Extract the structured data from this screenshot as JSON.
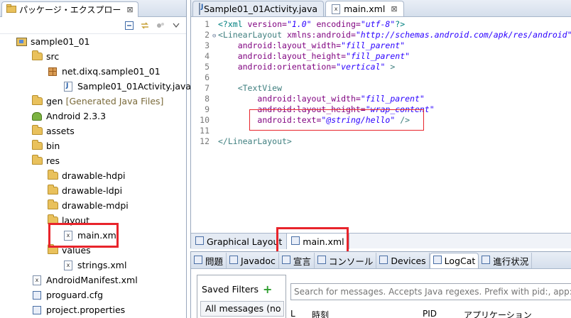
{
  "explorer": {
    "tab_title": "パッケージ・エクスプロー",
    "tab_close": "⊠",
    "tree": [
      {
        "label": "sample01_01",
        "icon": "project-icon",
        "indent": 0
      },
      {
        "label": "src",
        "icon": "folder-icon",
        "indent": 1
      },
      {
        "label": "net.dixq.sample01_01",
        "icon": "package-icon",
        "indent": 2
      },
      {
        "label": "Sample01_01Activity.java",
        "icon": "java-file-icon",
        "indent": 3
      },
      {
        "label": "gen",
        "extra": "[Generated Java Files]",
        "icon": "folder-icon",
        "indent": 1
      },
      {
        "label": "Android 2.3.3",
        "icon": "android-library-icon",
        "indent": 1
      },
      {
        "label": "assets",
        "icon": "folder-icon",
        "indent": 1
      },
      {
        "label": "bin",
        "icon": "folder-icon",
        "indent": 1
      },
      {
        "label": "res",
        "icon": "folder-icon",
        "indent": 1
      },
      {
        "label": "drawable-hdpi",
        "icon": "folder-icon",
        "indent": 2
      },
      {
        "label": "drawable-ldpi",
        "icon": "folder-icon",
        "indent": 2
      },
      {
        "label": "drawable-mdpi",
        "icon": "folder-icon",
        "indent": 2
      },
      {
        "label": "layout",
        "icon": "folder-icon",
        "indent": 2
      },
      {
        "label": "main.xml",
        "icon": "xml-file-icon",
        "indent": 3
      },
      {
        "label": "values",
        "icon": "folder-icon",
        "indent": 2
      },
      {
        "label": "strings.xml",
        "icon": "xml-file-icon",
        "indent": 3
      },
      {
        "label": "AndroidManifest.xml",
        "icon": "xml-file-icon",
        "indent": 1
      },
      {
        "label": "proguard.cfg",
        "icon": "file-icon",
        "indent": 1
      },
      {
        "label": "project.properties",
        "icon": "file-icon",
        "indent": 1
      }
    ]
  },
  "editor": {
    "tabs": [
      {
        "label": "Sample01_01Activity.java",
        "icon": "java-file-icon",
        "active": false
      },
      {
        "label": "main.xml",
        "icon": "xml-file-icon",
        "active": true,
        "close": "⊠"
      }
    ],
    "lines": [
      {
        "n": "1",
        "html": [
          [
            "pi",
            "<?xml "
          ],
          [
            "attr",
            "version="
          ],
          [
            "val",
            "\"1.0\""
          ],
          [
            "attr",
            " encoding="
          ],
          [
            "val",
            "\"utf-8\""
          ],
          [
            "pi",
            "?>"
          ]
        ]
      },
      {
        "n": "2",
        "fold": "⊖",
        "html": [
          [
            "tag",
            "<LinearLayout "
          ],
          [
            "attr",
            "xmlns:android="
          ],
          [
            "val",
            "\"http://schemas.android.com/apk/res/android\""
          ]
        ]
      },
      {
        "n": "3",
        "html": [
          [
            "tag",
            "    "
          ],
          [
            "attr",
            "android:layout_width="
          ],
          [
            "val",
            "\"fill_parent\""
          ]
        ]
      },
      {
        "n": "4",
        "html": [
          [
            "tag",
            "    "
          ],
          [
            "attr",
            "android:layout_height="
          ],
          [
            "val",
            "\"fill_parent\""
          ]
        ]
      },
      {
        "n": "5",
        "html": [
          [
            "tag",
            "    "
          ],
          [
            "attr",
            "android:orientation="
          ],
          [
            "val",
            "\"vertical\""
          ],
          [
            "tag",
            " >"
          ]
        ]
      },
      {
        "n": "6",
        "html": []
      },
      {
        "n": "7",
        "html": [
          [
            "tag",
            "    <TextView"
          ]
        ]
      },
      {
        "n": "8",
        "html": [
          [
            "tag",
            "        "
          ],
          [
            "attr",
            "android:layout_width="
          ],
          [
            "val",
            "\"fill_parent\""
          ]
        ]
      },
      {
        "n": "9",
        "html": [
          [
            "tag",
            "        "
          ],
          [
            "attr",
            "android:layout_height="
          ],
          [
            "val",
            "\"wrap_content\""
          ]
        ]
      },
      {
        "n": "10",
        "html": [
          [
            "tag",
            "        "
          ],
          [
            "attr",
            "android:text="
          ],
          [
            "val",
            "\"@string/hello\""
          ],
          [
            "tag",
            " />"
          ]
        ]
      },
      {
        "n": "11",
        "html": []
      },
      {
        "n": "12",
        "html": [
          [
            "tag",
            "</LinearLayout>"
          ]
        ]
      }
    ],
    "bottom_tabs": [
      {
        "label": "Graphical Layout",
        "icon": "layout-icon",
        "active": false
      },
      {
        "label": "main.xml",
        "icon": "xml-source-icon",
        "active": true
      }
    ]
  },
  "console": {
    "tabs": [
      {
        "label": "問題",
        "icon": "problems-icon"
      },
      {
        "label": "Javadoc",
        "icon": "javadoc-icon"
      },
      {
        "label": "宣言",
        "icon": "declaration-icon"
      },
      {
        "label": "コンソール",
        "icon": "console-icon"
      },
      {
        "label": "Devices",
        "icon": "device-icon"
      },
      {
        "label": "LogCat",
        "icon": "logcat-icon",
        "active": true
      },
      {
        "label": "進行状況",
        "icon": "progress-icon"
      }
    ],
    "saved_filters": "Saved Filters",
    "add_filter": "+",
    "all_messages": "All messages (no",
    "search_placeholder": "Search for messages. Accepts Java regexes. Prefix with pid:, app:,",
    "log_headers": [
      "L",
      "時刻",
      "PID",
      "アプリケーション"
    ]
  },
  "colors": {
    "highlight_red": "#e8242b"
  }
}
